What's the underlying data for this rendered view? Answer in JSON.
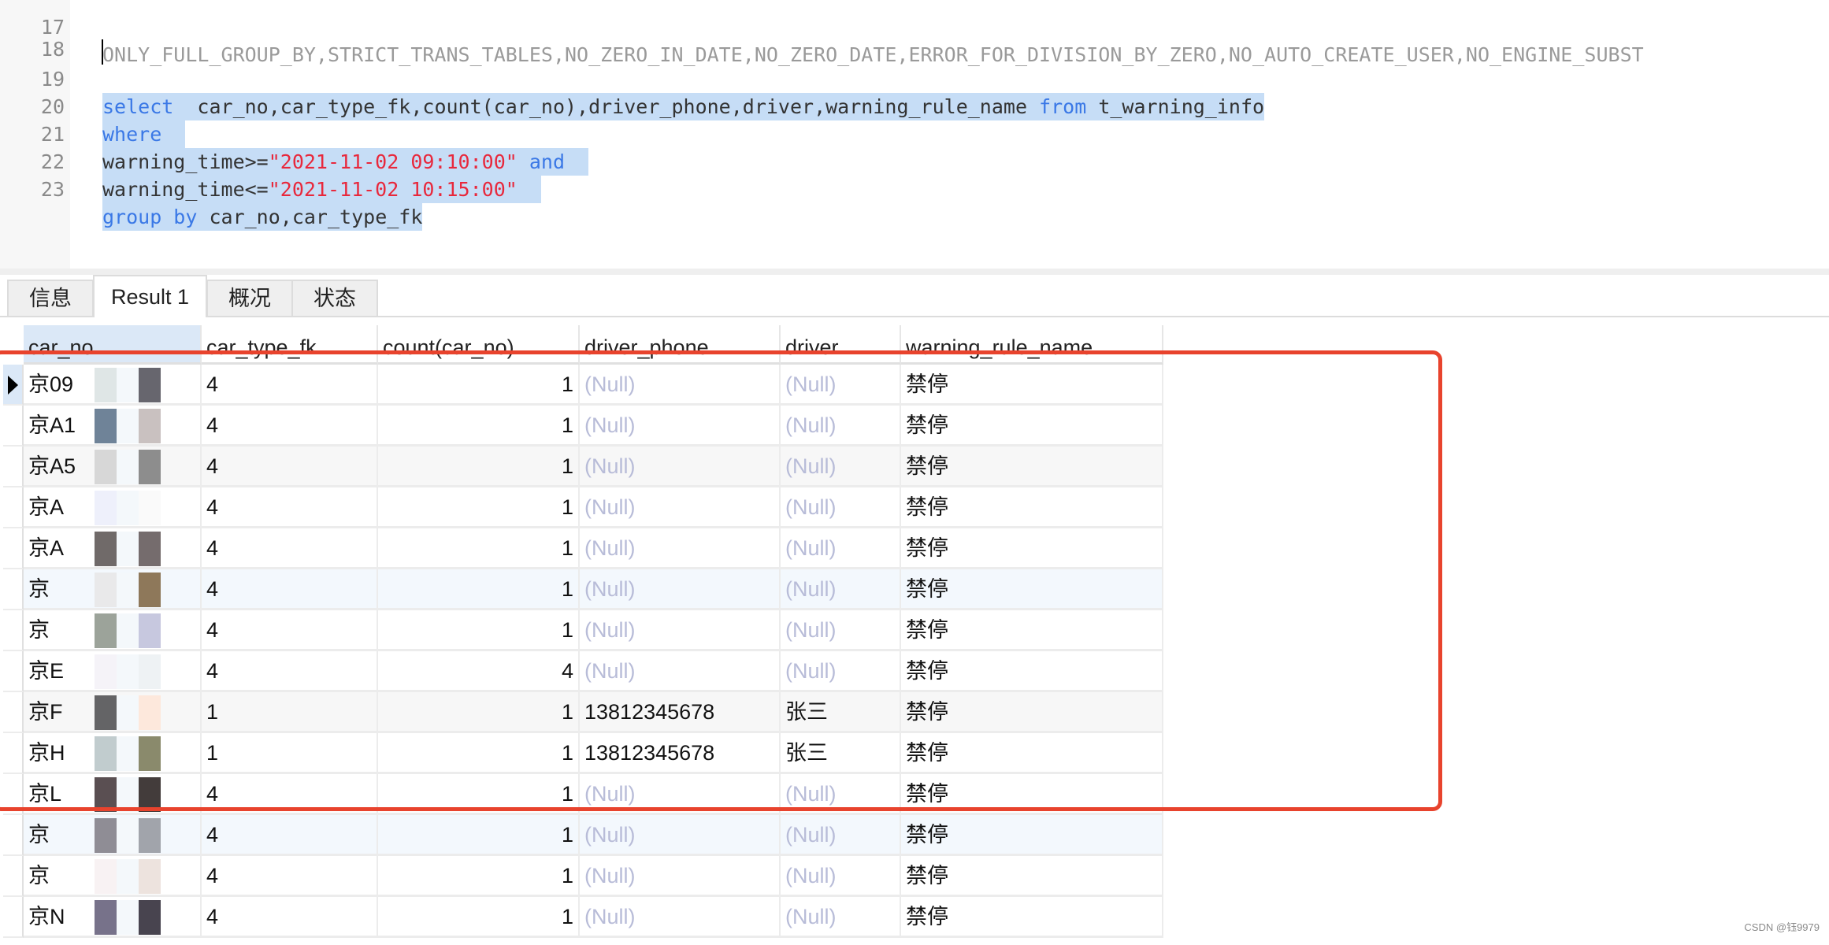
{
  "editor": {
    "lines": [
      {
        "no": "17",
        "text": "ONLY_FULL_GROUP_BY,STRICT_TRANS_TABLES,NO_ZERO_IN_DATE,NO_ZERO_DATE,ERROR_FOR_DIVISION_BY_ZERO,NO_AUTO_CREATE_USER,NO_ENGINE_SUBST"
      },
      {
        "no": "18"
      },
      {
        "no": "19",
        "kw1": "select",
        "rest": "  car_no,car_type_fk,count(car_no),driver_phone,driver,warning_rule_name ",
        "kw2": "from",
        "tail": " t_warning_info"
      },
      {
        "no": "20",
        "kw1": "where"
      },
      {
        "no": "21",
        "pre": "warning_time>=",
        "str": "\"2021-11-02 09:10:00\"",
        "mid": " ",
        "kw": "and"
      },
      {
        "no": "22",
        "pre": "warning_time<=",
        "str": "\"2021-11-02 10:15:00\""
      },
      {
        "no": "23",
        "kw": "group by",
        "rest": " car_no,car_type_fk"
      }
    ]
  },
  "tabs": [
    {
      "label": "信息",
      "active": false
    },
    {
      "label": "Result 1",
      "active": true
    },
    {
      "label": "概况",
      "active": false
    },
    {
      "label": "状态",
      "active": false
    }
  ],
  "grid": {
    "columns": [
      "car_no",
      "car_type_fk",
      "count(car_no)",
      "driver_phone",
      "driver",
      "warning_rule_name"
    ],
    "rows": [
      {
        "car_no": "京09",
        "car_type_fk": "4",
        "count": "1",
        "driver_phone": "(Null)",
        "driver": "(Null)",
        "warning_rule_name": "禁停"
      },
      {
        "car_no": "京A1",
        "car_type_fk": "4",
        "count": "1",
        "driver_phone": "(Null)",
        "driver": "(Null)",
        "warning_rule_name": "禁停"
      },
      {
        "car_no": "京A5",
        "car_type_fk": "4",
        "count": "1",
        "driver_phone": "(Null)",
        "driver": "(Null)",
        "warning_rule_name": "禁停"
      },
      {
        "car_no": "京A",
        "car_type_fk": "4",
        "count": "1",
        "driver_phone": "(Null)",
        "driver": "(Null)",
        "warning_rule_name": "禁停"
      },
      {
        "car_no": "京A",
        "car_type_fk": "4",
        "count": "1",
        "driver_phone": "(Null)",
        "driver": "(Null)",
        "warning_rule_name": "禁停"
      },
      {
        "car_no": "京",
        "car_type_fk": "4",
        "count": "1",
        "driver_phone": "(Null)",
        "driver": "(Null)",
        "warning_rule_name": "禁停"
      },
      {
        "car_no": "京",
        "car_type_fk": "4",
        "count": "1",
        "driver_phone": "(Null)",
        "driver": "(Null)",
        "warning_rule_name": "禁停"
      },
      {
        "car_no": "京E",
        "car_type_fk": "4",
        "count": "4",
        "driver_phone": "(Null)",
        "driver": "(Null)",
        "warning_rule_name": "禁停"
      },
      {
        "car_no": "京F",
        "car_type_fk": "1",
        "count": "1",
        "driver_phone": "13812345678",
        "driver": "张三",
        "warning_rule_name": "禁停"
      },
      {
        "car_no": "京H",
        "car_type_fk": "1",
        "count": "1",
        "driver_phone": "13812345678",
        "driver": "张三",
        "warning_rule_name": "禁停"
      },
      {
        "car_no": "京L",
        "car_type_fk": "4",
        "count": "1",
        "driver_phone": "(Null)",
        "driver": "(Null)",
        "warning_rule_name": "禁停"
      },
      {
        "car_no": "京",
        "car_type_fk": "4",
        "count": "1",
        "driver_phone": "(Null)",
        "driver": "(Null)",
        "warning_rule_name": "禁停"
      },
      {
        "car_no": "京",
        "car_type_fk": "4",
        "count": "1",
        "driver_phone": "(Null)",
        "driver": "(Null)",
        "warning_rule_name": "禁停"
      },
      {
        "car_no": "京N",
        "car_type_fk": "4",
        "count": "1",
        "driver_phone": "(Null)",
        "driver": "(Null)",
        "warning_rule_name": "禁停"
      }
    ]
  },
  "annotation": {
    "color": "#e8432d"
  },
  "watermark": "CSDN @钰9979"
}
